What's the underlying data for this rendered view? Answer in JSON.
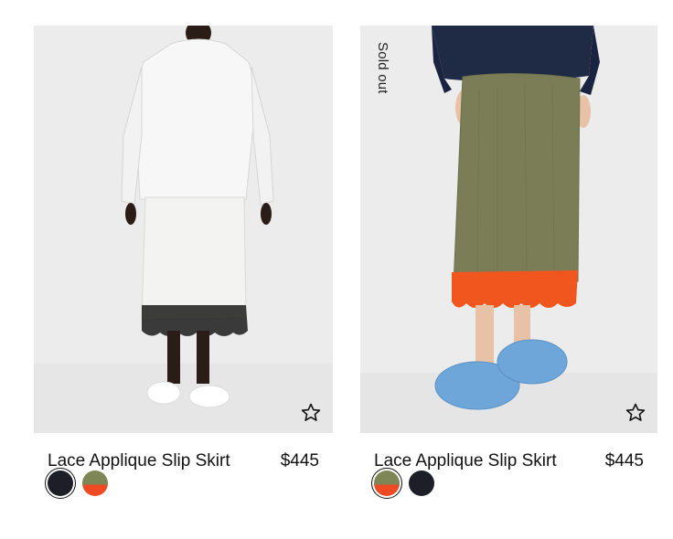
{
  "products": [
    {
      "name": "Lace Applique Slip Skirt",
      "price": "$445",
      "badge": "",
      "favorite_icon": "star-outline-icon",
      "swatches": [
        {
          "color": "#1d1e27",
          "label": "black",
          "selected": true
        },
        {
          "color": "#7f8656",
          "label": "olive",
          "selected": false
        }
      ]
    },
    {
      "name": "Lace Applique Slip Skirt",
      "price": "$445",
      "badge": "Sold out",
      "favorite_icon": "star-outline-icon",
      "swatches": [
        {
          "color": "#7f8656",
          "label": "olive",
          "selected": true
        },
        {
          "color": "#1d1e27",
          "label": "black",
          "selected": false
        }
      ]
    }
  ]
}
